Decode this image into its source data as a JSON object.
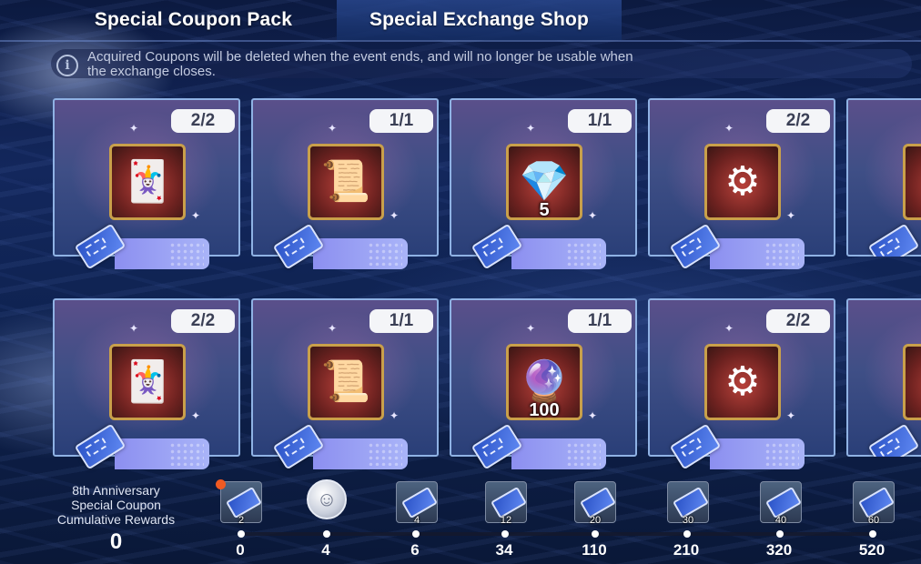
{
  "tabs": [
    {
      "label": "Special Coupon Pack"
    },
    {
      "label": "Special Exchange Shop"
    }
  ],
  "notice": {
    "text": "Acquired Coupons will be deleted when the event ends, and will no longer be usable when the exchange closes."
  },
  "cards": [
    {
      "stock": "2/2",
      "icon_name": "card-pack-icon",
      "icon": "🃏",
      "quantity": ""
    },
    {
      "stock": "1/1",
      "icon_name": "selector-card-icon",
      "icon": "📜",
      "quantity": ""
    },
    {
      "stock": "1/1",
      "icon_name": "crystal-icon",
      "icon": "💎",
      "quantity": "5"
    },
    {
      "stock": "2/2",
      "icon_name": "gear-token-icon",
      "icon": "⚙",
      "quantity": ""
    },
    {
      "stock": "",
      "icon_name": "partial-item-icon",
      "icon": "",
      "quantity": ""
    },
    {
      "stock": "2/2",
      "icon_name": "card-pack-icon",
      "icon": "🃏",
      "quantity": ""
    },
    {
      "stock": "1/1",
      "icon_name": "selector-card-icon",
      "icon": "📜",
      "quantity": ""
    },
    {
      "stock": "1/1",
      "icon_name": "rainbow-crystal-icon",
      "icon": "🔮",
      "quantity": "100"
    },
    {
      "stock": "2/2",
      "icon_name": "gear-token-icon",
      "icon": "⚙",
      "quantity": ""
    },
    {
      "stock": "",
      "icon_name": "partial-item-icon",
      "icon": "",
      "quantity": ""
    }
  ],
  "rewards": {
    "title": "8th Anniversary Special Coupon Cumulative Rewards",
    "count": "0",
    "milestones": [
      {
        "threshold": "0",
        "reward": "2",
        "type": "coupon"
      },
      {
        "threshold": "4",
        "reward": "",
        "type": "medal"
      },
      {
        "threshold": "6",
        "reward": "4",
        "type": "coupon"
      },
      {
        "threshold": "34",
        "reward": "12",
        "type": "coupon"
      },
      {
        "threshold": "110",
        "reward": "20",
        "type": "coupon"
      },
      {
        "threshold": "210",
        "reward": "30",
        "type": "coupon"
      },
      {
        "threshold": "320",
        "reward": "40",
        "type": "coupon"
      },
      {
        "threshold": "520",
        "reward": "60",
        "type": "coupon"
      }
    ]
  },
  "colors": {
    "tab_active_bg": "#1e3c82",
    "badge_bg": "#f4f5f8",
    "price_bar": "#9aa3f4",
    "card_border": "#8fb2e4",
    "notification_dot": "#f05a22"
  }
}
